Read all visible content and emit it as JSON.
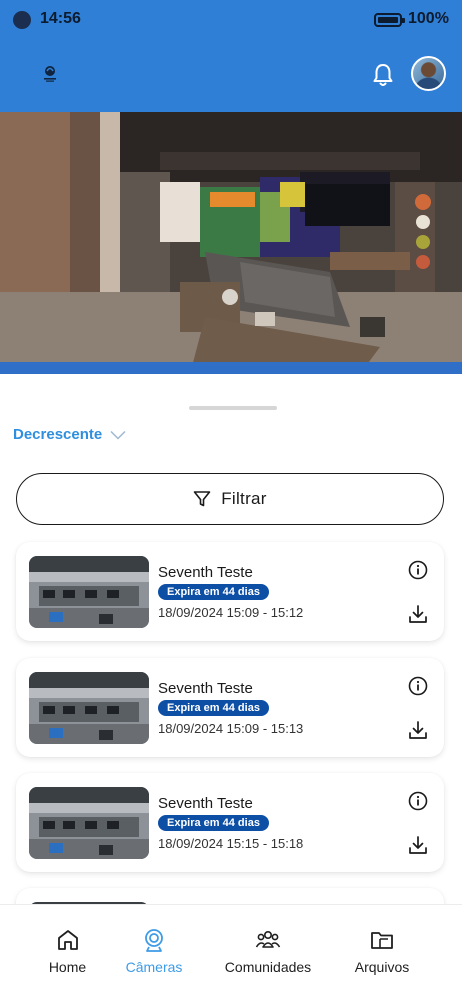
{
  "status_bar": {
    "time": "14:56",
    "battery": "100%"
  },
  "header": {
    "logo_icon": "company-logo-icon",
    "notifications_icon": "bell-icon",
    "avatar_icon": "user-avatar"
  },
  "colors": {
    "header_blue": "#2f7fd6",
    "accent": "#2f8fde",
    "badge_blue": "#0e4fa6",
    "nav_active": "#3e9be6"
  },
  "sort": {
    "label": "Decrescente",
    "icon": "chevron-down-icon"
  },
  "filter": {
    "label": "Filtrar",
    "icon": "filter-icon"
  },
  "recordings": [
    {
      "title": "Seventh Teste",
      "badge": "Expira em 44 dias",
      "time": "18/09/2024 15:09 -  15:12"
    },
    {
      "title": "Seventh Teste",
      "badge": "Expira em 44 dias",
      "time": "18/09/2024 15:09 -  15:13"
    },
    {
      "title": "Seventh Teste",
      "badge": "Expira em 44 dias",
      "time": "18/09/2024 15:15 -  15:18"
    }
  ],
  "nav": [
    {
      "label": "Home",
      "icon": "home-icon",
      "active": false
    },
    {
      "label": "Câmeras",
      "icon": "camera-icon",
      "active": true
    },
    {
      "label": "Comunidades",
      "icon": "community-icon",
      "active": false
    },
    {
      "label": "Arquivos",
      "icon": "folder-icon",
      "active": false
    }
  ]
}
